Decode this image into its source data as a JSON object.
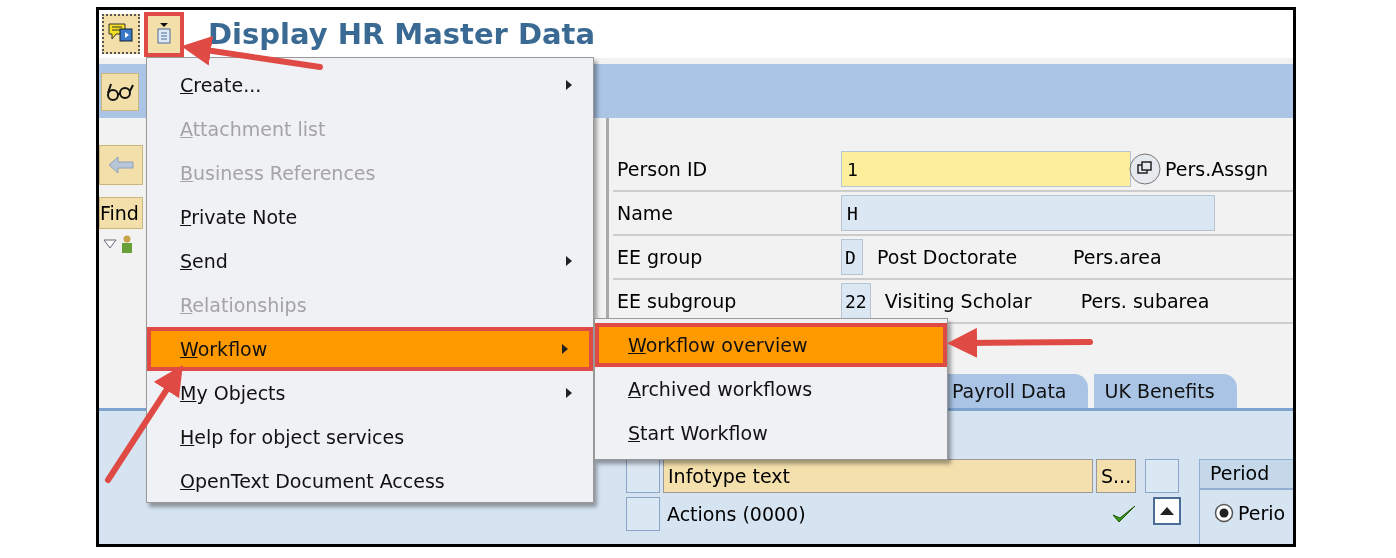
{
  "title_bar": {
    "title": "Display HR Master Data"
  },
  "left_panel": {
    "find_button": "Find"
  },
  "form": {
    "rows": [
      {
        "kind": "key",
        "label": "Person ID",
        "value": "1",
        "trailing": "Pers.Assgn"
      },
      {
        "kind": "wide",
        "label": "Name",
        "value": "H"
      },
      {
        "kind": "code",
        "label": "EE group",
        "value": "D",
        "description": "Post Doctorate",
        "extra_label": "Pers.area"
      },
      {
        "kind": "code",
        "label": "EE subgroup",
        "value": "22",
        "description": "Visiting Scholar",
        "extra_label": "Pers. subarea"
      }
    ]
  },
  "tabs": [
    {
      "label": "Payroll Data",
      "selected": false
    },
    {
      "label": "UK Benefits",
      "selected": false
    }
  ],
  "infotype_table": {
    "columns": [
      "Infotype text",
      "S..."
    ],
    "rows": [
      {
        "text": "Actions (0000)",
        "checked": true
      }
    ]
  },
  "period": {
    "title": "Period",
    "options": [
      {
        "label": "Perio",
        "selected": true
      }
    ]
  },
  "context_menu": {
    "items": [
      {
        "label": "Create...",
        "disabled": false,
        "submenu": true,
        "selected": false
      },
      {
        "label": "Attachment list",
        "disabled": true,
        "submenu": false,
        "selected": false
      },
      {
        "label": "Business References",
        "disabled": true,
        "submenu": false,
        "selected": false
      },
      {
        "label": "Private Note",
        "disabled": false,
        "submenu": false,
        "selected": false
      },
      {
        "label": "Send",
        "disabled": false,
        "submenu": true,
        "selected": false
      },
      {
        "label": "Relationships",
        "disabled": true,
        "submenu": false,
        "selected": false
      },
      {
        "label": "Workflow",
        "disabled": false,
        "submenu": true,
        "selected": true
      },
      {
        "label": "My Objects",
        "disabled": false,
        "submenu": true,
        "selected": false
      },
      {
        "label": "Help for object services",
        "disabled": false,
        "submenu": false,
        "selected": false
      },
      {
        "label": "OpenText Document Access",
        "disabled": false,
        "submenu": false,
        "selected": false
      }
    ]
  },
  "submenu": {
    "items": [
      {
        "label": "Workflow overview",
        "selected": true
      },
      {
        "label": "Archived workflows",
        "selected": false
      },
      {
        "label": "Start Workflow",
        "selected": false
      }
    ]
  }
}
